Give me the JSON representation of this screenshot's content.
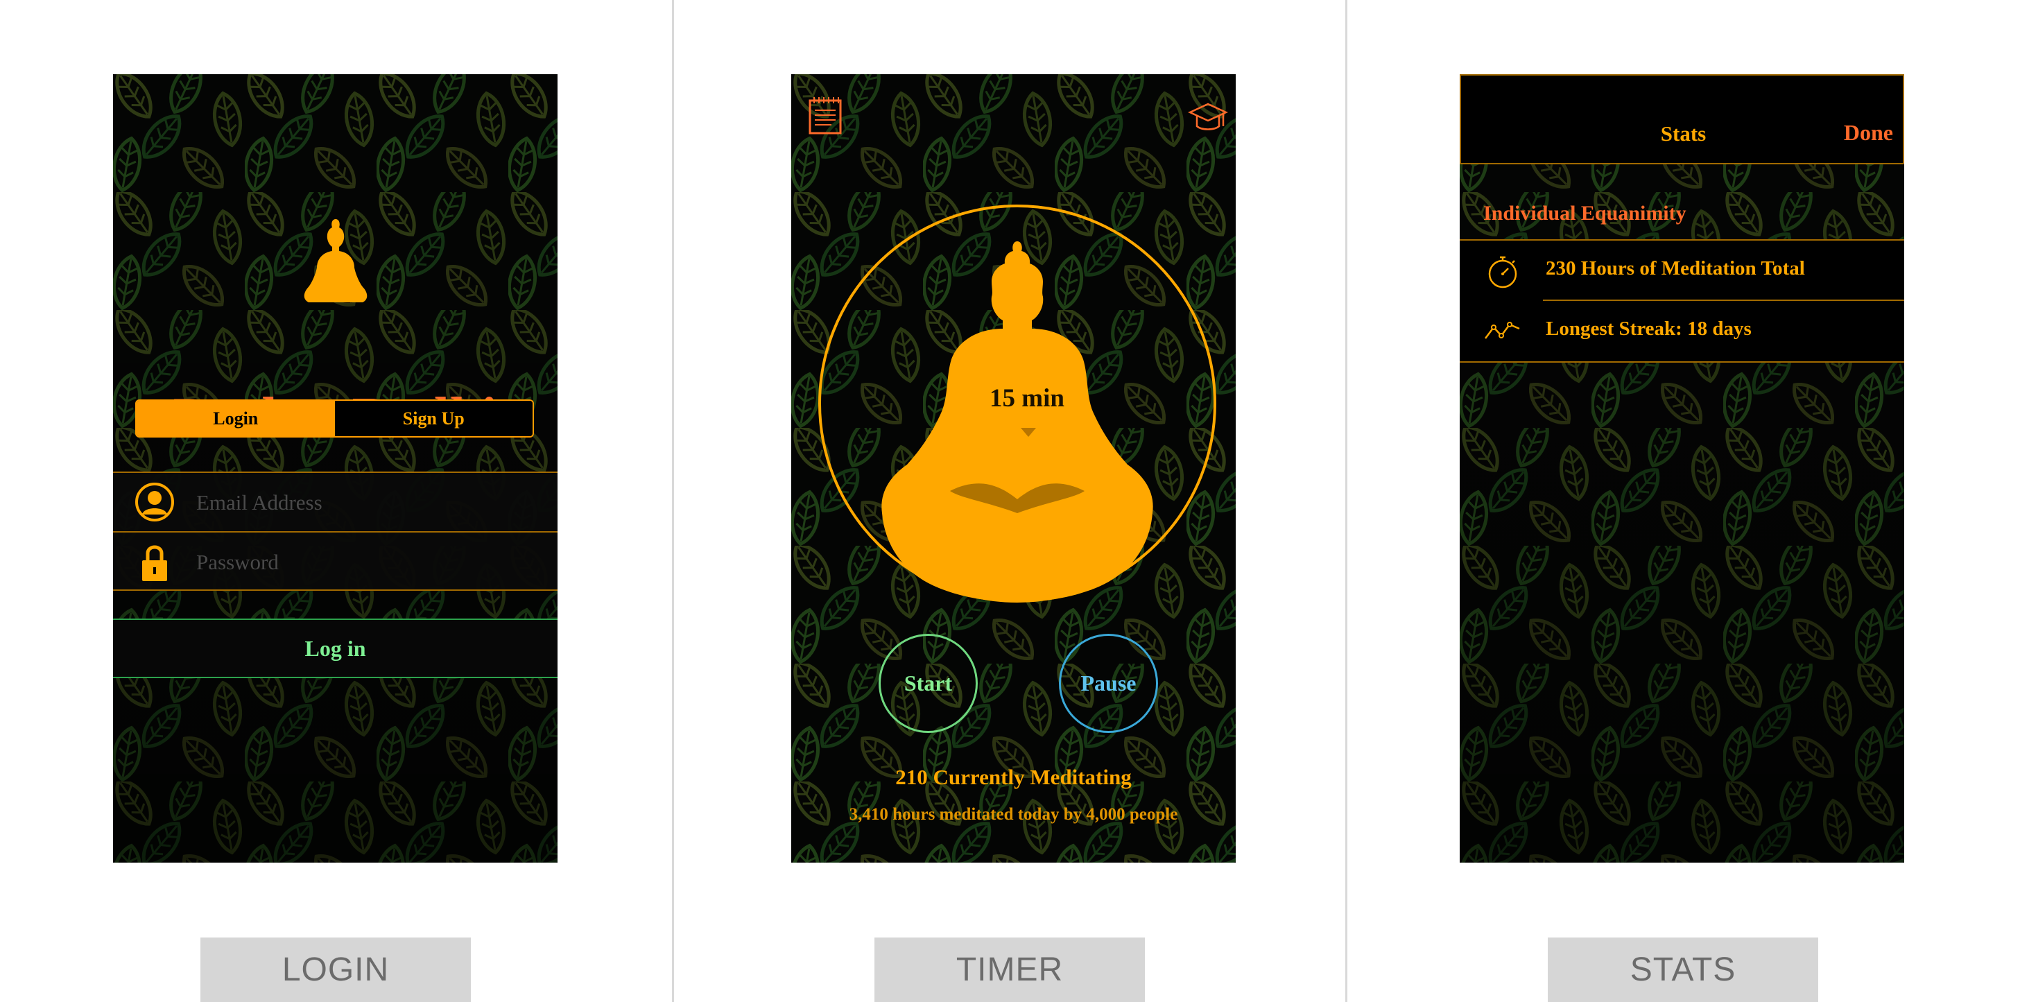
{
  "screens": {
    "login": {
      "caption": "LOGIN",
      "app_title": "Pocket Bodhi",
      "tabs": [
        {
          "label": "Login",
          "active": true
        },
        {
          "label": "Sign Up",
          "active": false
        }
      ],
      "email_placeholder": "Email Address",
      "email_value": "",
      "password_placeholder": "Password",
      "password_value": "",
      "submit_label": "Log in"
    },
    "timer": {
      "caption": "TIMER",
      "duration_label": "15 min",
      "start_label": "Start",
      "pause_label": "Pause",
      "currently_meditating": "210 Currently Meditating",
      "today_summary": "3,410 hours meditated today by 4,000 people",
      "icons": {
        "left": "notepad-icon",
        "right": "graduation-cap-icon"
      }
    },
    "stats": {
      "caption": "STATS",
      "header_title": "Stats",
      "done_label": "Done",
      "section_title": "Individual Equanimity",
      "rows": [
        {
          "icon": "stopwatch-icon",
          "text": "230 Hours of Meditation Total"
        },
        {
          "icon": "trend-line-icon",
          "text": "Longest Streak: 18 days"
        }
      ]
    }
  },
  "colors": {
    "accent_orange": "#ffa800",
    "brand_red_orange": "#ff6a2a",
    "start_green": "#86ef93",
    "pause_blue": "#5fc3ee",
    "background": "#040504",
    "caption_bg": "#d6d6d6"
  }
}
